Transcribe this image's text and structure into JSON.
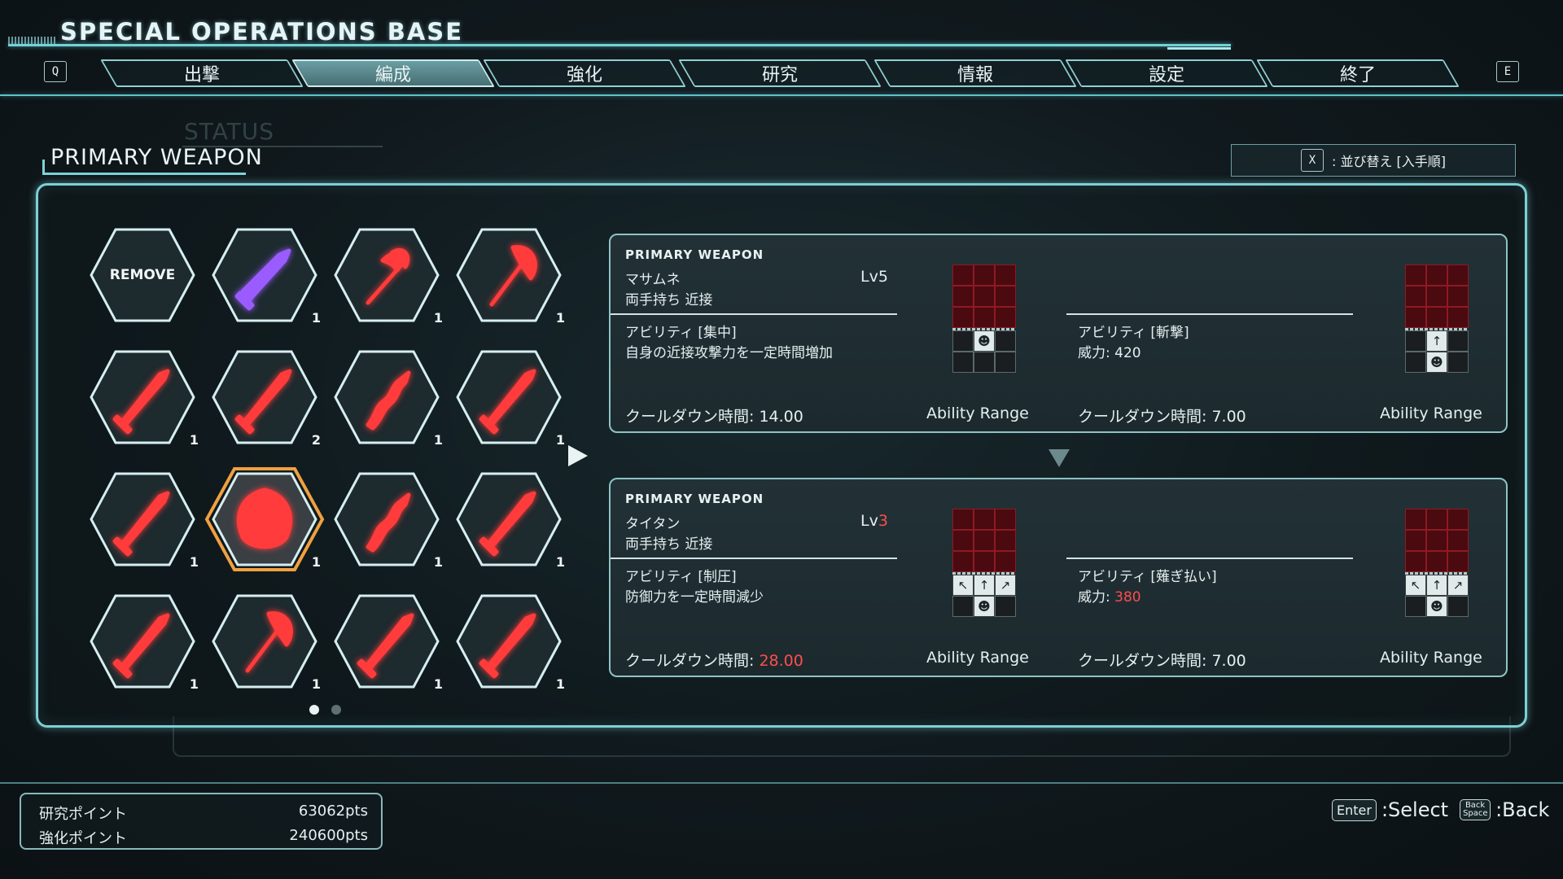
{
  "header": {
    "title": "SPECIAL OPERATIONS BASE",
    "left_key": "Q",
    "right_key": "E",
    "tabs": [
      {
        "label": "出撃",
        "active": false
      },
      {
        "label": "編成",
        "active": true
      },
      {
        "label": "強化",
        "active": false
      },
      {
        "label": "研究",
        "active": false
      },
      {
        "label": "情報",
        "active": false
      },
      {
        "label": "設定",
        "active": false
      },
      {
        "label": "終了",
        "active": false
      }
    ]
  },
  "section": {
    "ghost_title": "STATUS",
    "title": "PRIMARY WEAPON"
  },
  "sort": {
    "key": "X",
    "label": ": 並び替え [入手順]"
  },
  "inventory": {
    "remove_label": "REMOVE",
    "items": [
      {
        "icon": "violet-dagger-icon",
        "color": "#9b5cff",
        "count": "1"
      },
      {
        "icon": "red-halberd-icon",
        "color": "#ff3b3b",
        "count": "1"
      },
      {
        "icon": "red-axe-icon",
        "color": "#ff3b3b",
        "count": "1"
      },
      {
        "icon": "red-spear-icon",
        "color": "#ff3b3b",
        "count": "1"
      },
      {
        "icon": "red-broadsword-icon",
        "color": "#ff3b3b",
        "count": "2"
      },
      {
        "icon": "red-serpent-blade-icon",
        "color": "#ff3b3b",
        "count": "1"
      },
      {
        "icon": "red-cleaver-icon",
        "color": "#ff3b3b",
        "count": "1"
      },
      {
        "icon": "red-greatsword-icon",
        "color": "#ff3b3b",
        "count": "1"
      },
      {
        "icon": "red-titan-axe-icon",
        "color": "#ff3b3b",
        "count": "1",
        "selected": true
      },
      {
        "icon": "red-jagged-blade-icon",
        "color": "#ff3b3b",
        "count": "1"
      },
      {
        "icon": "red-saber-icon",
        "color": "#ff3b3b",
        "count": "1"
      },
      {
        "icon": "red-lance-icon",
        "color": "#ff3b3b",
        "count": "1"
      },
      {
        "icon": "red-double-axe-icon",
        "color": "#ff3b3b",
        "count": "1"
      },
      {
        "icon": "red-katana-icon",
        "color": "#ff3b3b",
        "count": "1"
      },
      {
        "icon": "red-longsword-icon",
        "color": "#ff3b3b",
        "count": "1"
      }
    ],
    "page_indicator": {
      "current": 1,
      "total": 2
    }
  },
  "cards": [
    {
      "label": "PRIMARY WEAPON",
      "name": "マサムネ",
      "level_prefix": "Lv",
      "level": "5",
      "level_changed": false,
      "type": "両手持ち 近接",
      "ability1": {
        "title": "アビリティ [集中]",
        "desc": "自身の近接攻撃力を一定時間増加",
        "cooldown_label": "クールダウン時間: ",
        "cooldown": "14.00",
        "cooldown_changed": false,
        "range_label": "Ability Range"
      },
      "ability2": {
        "title": "アビリティ [斬撃]",
        "power_label": "威力: ",
        "power": "420",
        "power_changed": false,
        "cooldown_label": "クールダウン時間: ",
        "cooldown": "7.00",
        "range_label": "Ability Range"
      }
    },
    {
      "label": "PRIMARY WEAPON",
      "name": "タイタン",
      "level_prefix": "Lv",
      "level": "3",
      "level_changed": true,
      "type": "両手持ち 近接",
      "ability1": {
        "title": "アビリティ [制圧]",
        "desc": "防御力を一定時間減少",
        "cooldown_label": "クールダウン時間: ",
        "cooldown": "28.00",
        "cooldown_changed": true,
        "range_label": "Ability Range"
      },
      "ability2": {
        "title": "アビリティ [薙ぎ払い]",
        "power_label": "威力: ",
        "power": "380",
        "power_changed": true,
        "cooldown_label": "クールダウン時間: ",
        "cooldown": "7.00",
        "range_label": "Ability Range"
      }
    }
  ],
  "footer": {
    "points": [
      {
        "label": "研究ポイント",
        "value": "63062pts"
      },
      {
        "label": "強化ポイント",
        "value": "240600pts"
      }
    ],
    "controls": {
      "select_key": "Enter",
      "select_label": ":Select",
      "back_key": "Back Space",
      "back_label": ":Back"
    }
  },
  "colors": {
    "accent": "#7cd0d5",
    "changed_value": "#ff4d4d",
    "selected_border": "#f0a040"
  }
}
